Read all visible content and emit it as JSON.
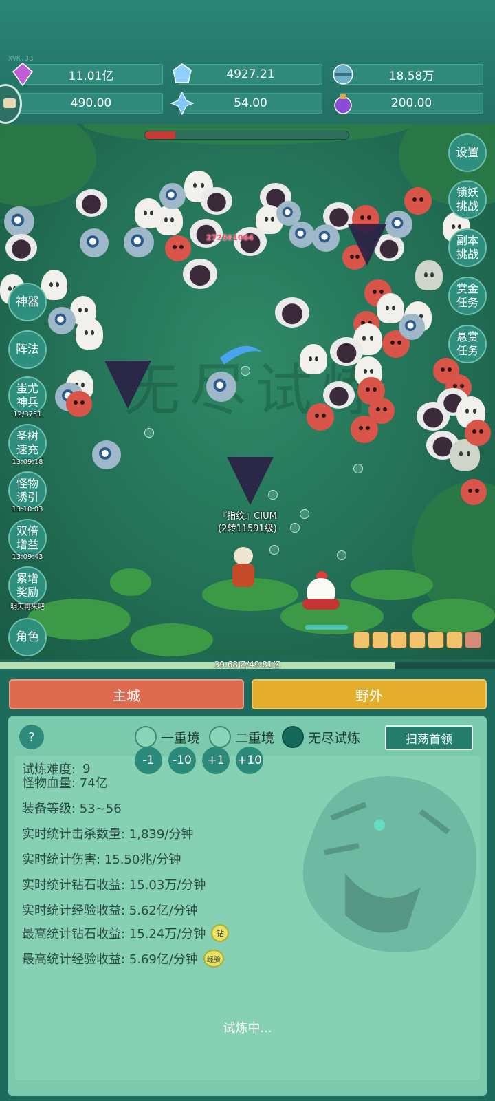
{
  "top": {
    "tag": "XVK.JB",
    "resources": [
      {
        "icon": "diamond-icon",
        "value": "11.01亿",
        "color": "#c15bd6"
      },
      {
        "icon": "blue-crystal-icon",
        "value": "4927.21",
        "color": "#8fd0ff"
      },
      {
        "icon": "orb-icon",
        "value": "18.58万",
        "color": "#6fb0c9"
      },
      {
        "icon": "scroll-icon",
        "value": "490.00",
        "color": "#e2b77a"
      },
      {
        "icon": "ice-shard-icon",
        "value": "54.00",
        "color": "#7ec8ff"
      },
      {
        "icon": "potion-icon",
        "value": "200.00",
        "color": "#8a4bd6"
      }
    ]
  },
  "battle": {
    "boss_hp_fraction": 0.15,
    "damage_popup": "272561064",
    "watermark": "无尽试炼",
    "player_name": "『指纹』CIUM",
    "player_level": "(2转11591级)",
    "exp_text": "39.68亿/49.81亿",
    "exp_fraction": 0.7966
  },
  "left_buttons": [
    {
      "label": "神器",
      "timer": ""
    },
    {
      "label": "阵法",
      "timer": ""
    },
    {
      "label": "蚩尤神兵",
      "timer": "12/3751"
    },
    {
      "label": "圣树速充",
      "timer": "13:09:18"
    },
    {
      "label": "怪物诱引",
      "timer": "13:10:03"
    },
    {
      "label": "双倍增益",
      "timer": "13:09:43"
    },
    {
      "label": "累增奖励",
      "timer": "明天再来吧"
    },
    {
      "label": "角色",
      "timer": ""
    }
  ],
  "right_buttons": [
    {
      "label": "设置"
    },
    {
      "label": "锁妖挑战"
    },
    {
      "label": "副本挑战"
    },
    {
      "label": "赏金任务"
    },
    {
      "label": "悬赏任务"
    }
  ],
  "tabs": {
    "main_city": "主城",
    "wild": "野外"
  },
  "panel": {
    "help": "?",
    "modes": [
      "一重境",
      "二重境",
      "无尽试炼"
    ],
    "selected_mode": "无尽试炼",
    "sweep_label": "扫荡首领",
    "difficulty_label": "试炼难度:",
    "difficulty_value": "9",
    "difficulty_buttons": [
      "-1",
      "-10",
      "+1",
      "+10"
    ],
    "stats": [
      "怪物血量: 74亿",
      "装备等级: 53~56",
      "实时统计击杀数量: 1,839/分钟",
      "实时统计伤害: 15.50兆/分钟",
      "实时统计钻石收益: 15.03万/分钟",
      "实时统计经验收益: 5.62亿/分钟",
      "最高统计钻石收益: 15.24万/分钟",
      "最高统计经验收益: 5.69亿/分钟"
    ],
    "badge_diamond": "钻",
    "badge_exp": "经验",
    "status": "试炼中..."
  }
}
